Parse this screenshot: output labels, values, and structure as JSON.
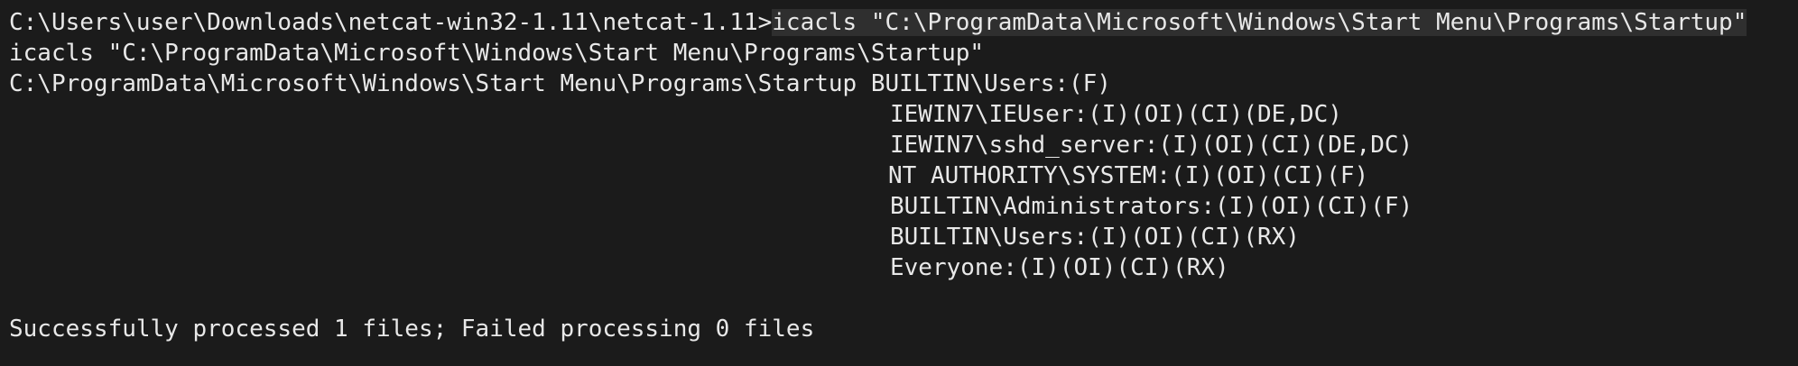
{
  "terminal": {
    "prompt": "C:\\Users\\user\\Downloads\\netcat-win32-1.11\\netcat-1.11>",
    "command": "icacls \"C:\\ProgramData\\Microsoft\\Windows\\Start Menu\\Programs\\Startup\"",
    "echo": "icacls \"C:\\ProgramData\\Microsoft\\Windows\\Start Menu\\Programs\\Startup\"",
    "path": "C:\\ProgramData\\Microsoft\\Windows\\Start Menu\\Programs\\Startup",
    "first_ace": " BUILTIN\\Users:(F)",
    "aces": [
      "IEWIN7\\IEUser:(I)(OI)(CI)(DE,DC)",
      "IEWIN7\\sshd_server:(I)(OI)(CI)(DE,DC)",
      "NT AUTHORITY\\SYSTEM:(I)(OI)(CI)(F)",
      "BUILTIN\\Administrators:(I)(OI)(CI)(F)",
      "BUILTIN\\Users:(I)(OI)(CI)(RX)",
      "Everyone:(I)(OI)(CI)(RX)"
    ],
    "summary": "Successfully processed 1 files; Failed processing 0 files"
  },
  "colors": {
    "background": "#1b1b1b",
    "text": "#e8e8e8",
    "command_highlight": "#2f2f2f"
  }
}
